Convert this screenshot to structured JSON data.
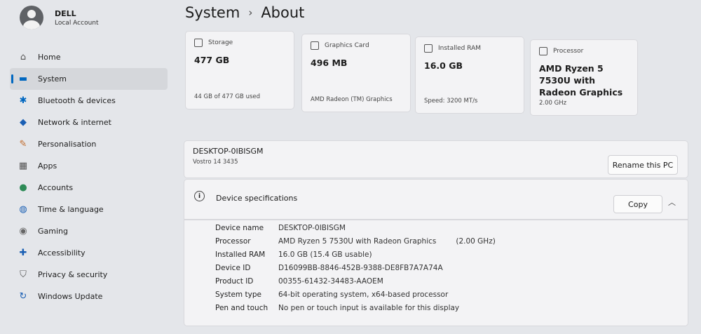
{
  "user": {
    "name": "DELL",
    "account_type": "Local Account"
  },
  "nav": [
    {
      "label": "Home",
      "icon": "home-icon",
      "glyph": "⌂",
      "color": "#555555"
    },
    {
      "label": "System",
      "icon": "system-icon",
      "glyph": "▬",
      "color": "#0067c0"
    },
    {
      "label": "Bluetooth & devices",
      "icon": "bluetooth-icon",
      "glyph": "✱",
      "color": "#0067c0"
    },
    {
      "label": "Network & internet",
      "icon": "wifi-icon",
      "glyph": "◆",
      "color": "#1a5fb4"
    },
    {
      "label": "Personalisation",
      "icon": "brush-icon",
      "glyph": "✎",
      "color": "#c06a2b"
    },
    {
      "label": "Apps",
      "icon": "apps-icon",
      "glyph": "▦",
      "color": "#555555"
    },
    {
      "label": "Accounts",
      "icon": "accounts-icon",
      "glyph": "●",
      "color": "#2e8b57"
    },
    {
      "label": "Time & language",
      "icon": "globe-icon",
      "glyph": "◍",
      "color": "#1a5fb4"
    },
    {
      "label": "Gaming",
      "icon": "gamepad-icon",
      "glyph": "◉",
      "color": "#666666"
    },
    {
      "label": "Accessibility",
      "icon": "accessibility-icon",
      "glyph": "✚",
      "color": "#1a5fb4"
    },
    {
      "label": "Privacy & security",
      "icon": "shield-icon",
      "glyph": "⛉",
      "color": "#555555"
    },
    {
      "label": "Windows Update",
      "icon": "update-icon",
      "glyph": "↻",
      "color": "#1a5fb4"
    }
  ],
  "breadcrumb": {
    "parent": "System",
    "separator": "›",
    "current": "About"
  },
  "cards": [
    {
      "label": "Storage",
      "value": "477 GB",
      "footer": "44 GB of 477 GB used",
      "icon": "storage-icon"
    },
    {
      "label": "Graphics Card",
      "value": "496 MB",
      "footer": "AMD Radeon (TM) Graphics",
      "icon": "gpu-icon"
    },
    {
      "label": "Installed RAM",
      "value": "16.0 GB",
      "footer": "Speed: 3200 MT/s",
      "icon": "ram-icon"
    },
    {
      "label": "Processor",
      "value": "AMD Ryzen 5 7530U with Radeon Graphics",
      "footer": "2.00 GHz",
      "icon": "cpu-icon"
    }
  ],
  "pc": {
    "name": "DESKTOP-0IBISGM",
    "model": "Vostro 14 3435",
    "rename_label": "Rename this PC"
  },
  "specs": {
    "title": "Device specifications",
    "copy_label": "Copy",
    "rows": [
      {
        "key": "Device name",
        "value": "DESKTOP-0IBISGM"
      },
      {
        "key": "Processor",
        "value": "AMD Ryzen 5 7530U with Radeon Graphics",
        "extra": "(2.00 GHz)"
      },
      {
        "key": "Installed RAM",
        "value": "16.0 GB (15.4 GB usable)"
      },
      {
        "key": "Device ID",
        "value": "D16099BB-8846-452B-9388-DE8FB7A7A74A"
      },
      {
        "key": "Product ID",
        "value": "00355-61432-34483-AAOEM"
      },
      {
        "key": "System type",
        "value": "64-bit operating system, x64-based processor"
      },
      {
        "key": "Pen and touch",
        "value": "No pen or touch input is available for this display"
      }
    ]
  },
  "colors": {
    "accent": "#0067c0",
    "background": "#e4e6ea",
    "card": "#f3f3f5"
  }
}
